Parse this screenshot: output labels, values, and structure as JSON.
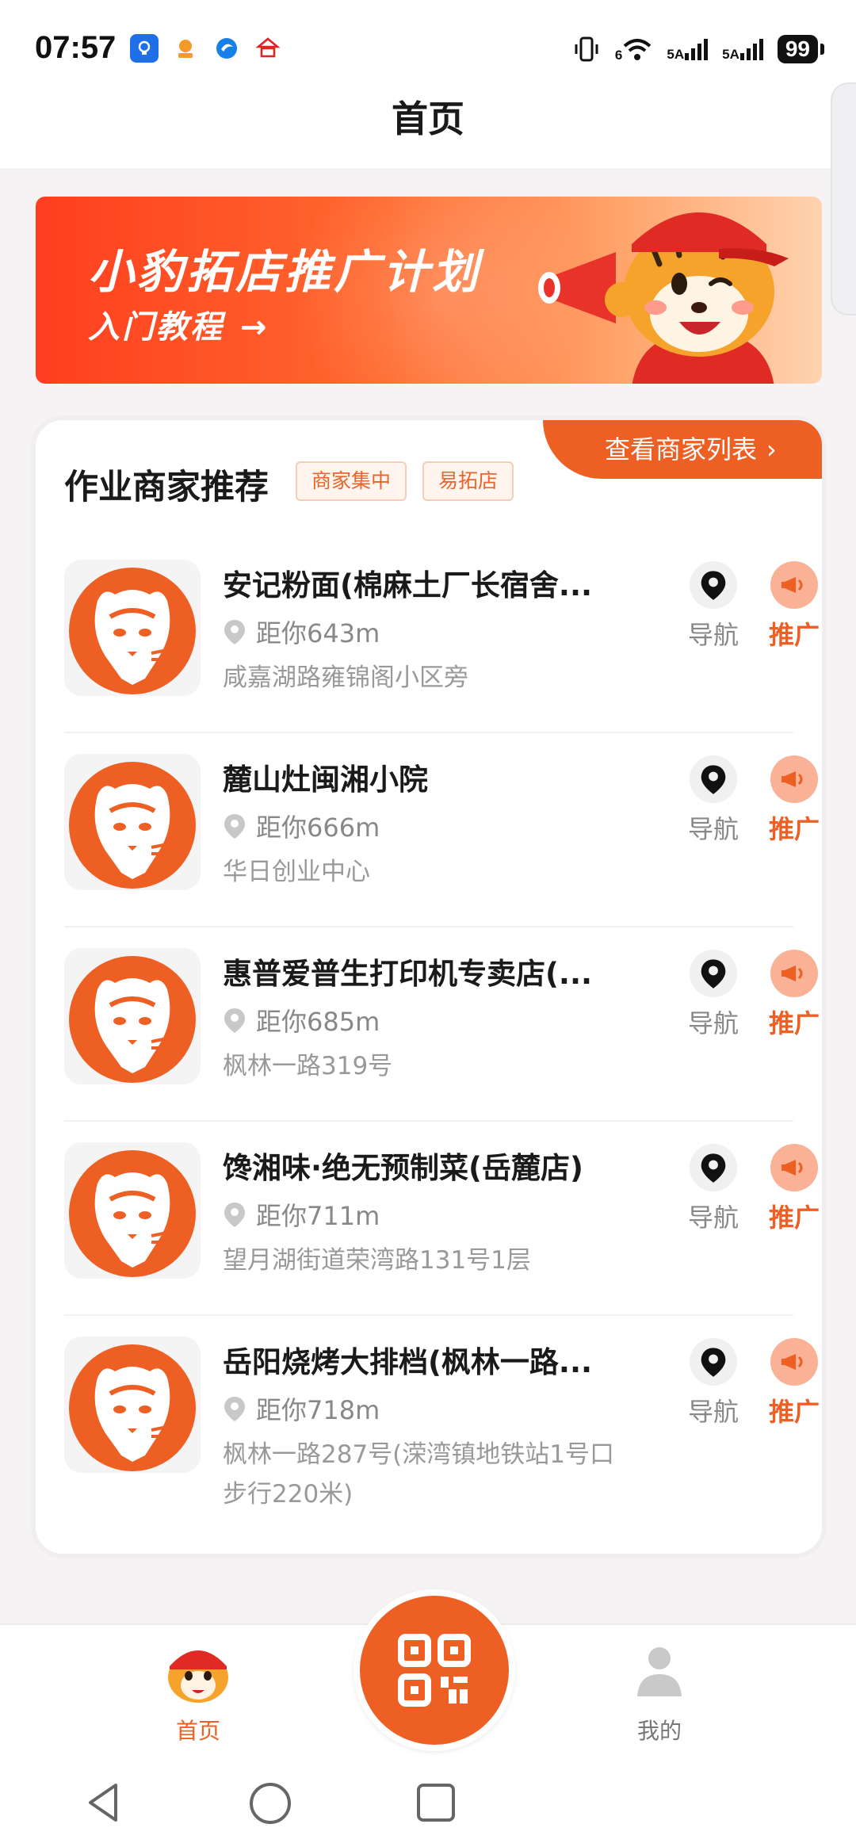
{
  "status_bar": {
    "time": "07:57",
    "signal1": "5A",
    "signal2": "5A",
    "wifi_label": "6",
    "battery": "99"
  },
  "header": {
    "title": "首页"
  },
  "banner": {
    "title": "小豹拓店推广计划",
    "subtitle": "入门教程",
    "arrow": "→"
  },
  "section": {
    "title": "作业商家推荐",
    "tags": [
      "商家集中",
      "易拓店"
    ],
    "view_list": "查看商家列表",
    "view_list_chevron": "›"
  },
  "merchants": [
    {
      "name": "安记粉面(棉麻土厂长宿舍...",
      "distance": "距你643m",
      "address": "咸嘉湖路雍锦阁小区旁"
    },
    {
      "name": "麓山灶闽湘小院",
      "distance": "距你666m",
      "address": "华日创业中心"
    },
    {
      "name": "惠普爱普生打印机专卖店(...",
      "distance": "距你685m",
      "address": "枫林一路319号"
    },
    {
      "name": "馋湘味·绝无预制菜(岳麓店)",
      "distance": "距你711m",
      "address": "望月湖街道荣湾路131号1层"
    },
    {
      "name": "岳阳烧烤大排档(枫林一路...",
      "distance": "距你718m",
      "address": "枫林一路287号(溁湾镇地铁站1号口步行220米)"
    }
  ],
  "actions": {
    "nav_label": "导航",
    "promo_label": "推广"
  },
  "tabs": {
    "home": "首页",
    "mine": "我的"
  },
  "colors": {
    "accent": "#ee5f24",
    "banner_start": "#ff3e1f",
    "banner_end": "#ffd3b0"
  }
}
